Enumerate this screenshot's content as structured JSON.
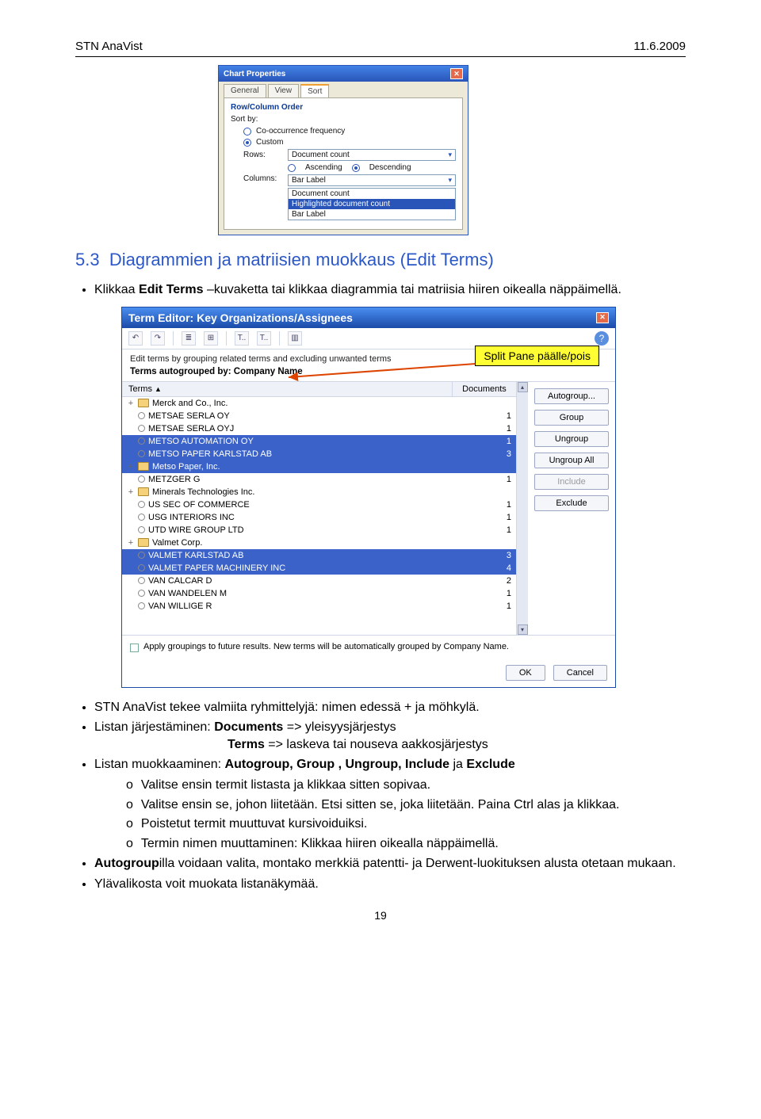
{
  "header": {
    "left": "STN AnaVist",
    "right": "11.6.2009"
  },
  "chartProps": {
    "title": "Chart Properties",
    "tabs": [
      "General",
      "View",
      "Sort"
    ],
    "rowColOrder": "Row/Column Order",
    "sortBy": "Sort by:",
    "opt1": "Co-occurrence frequency",
    "opt2": "Custom",
    "rows": "Rows:",
    "rowsVal": "Document count",
    "asc": "Ascending",
    "desc": "Descending",
    "cols": "Columns:",
    "colsVal": "Bar Label",
    "listItems": [
      "Document count",
      "Highlighted document count",
      "Bar Label"
    ]
  },
  "section": {
    "num": "5.3",
    "title": "Diagrammien ja matriisien muokkaus (Edit Terms)"
  },
  "bullet1a": "Klikkaa ",
  "bullet1b": "Edit Terms",
  "bullet1c": " –kuvaketta tai klikkaa diagrammia tai matriisia hiiren oikealla näppäimellä.",
  "termEditor": {
    "title": "Term Editor: Key Organizations/Assignees",
    "desc": "Edit terms by grouping related terms and excluding unwanted terms",
    "autogrouped": "Terms autogrouped by: Company Name",
    "col1": "Terms",
    "col2": "Documents",
    "rows": [
      {
        "exp": "+",
        "icon": "folder",
        "name": "Merck and Co., Inc.",
        "val": "",
        "sel": false
      },
      {
        "exp": "",
        "icon": "circ",
        "name": "METSAE SERLA OY",
        "val": "1",
        "sel": false
      },
      {
        "exp": "",
        "icon": "circ",
        "name": "METSAE SERLA OYJ",
        "val": "1",
        "sel": false
      },
      {
        "exp": "",
        "icon": "circ",
        "name": "METSO AUTOMATION OY",
        "val": "1",
        "sel": true
      },
      {
        "exp": "",
        "icon": "circ",
        "name": "METSO PAPER KARLSTAD AB",
        "val": "3",
        "sel": true
      },
      {
        "exp": "+",
        "icon": "folder",
        "name": "Metso Paper, Inc.",
        "val": "",
        "sel": true
      },
      {
        "exp": "",
        "icon": "circ",
        "name": "METZGER G",
        "val": "1",
        "sel": false
      },
      {
        "exp": "+",
        "icon": "folder",
        "name": "Minerals Technologies Inc.",
        "val": "",
        "sel": false
      },
      {
        "exp": "",
        "icon": "circ",
        "name": "US SEC OF COMMERCE",
        "val": "1",
        "sel": false
      },
      {
        "exp": "",
        "icon": "circ",
        "name": "USG INTERIORS INC",
        "val": "1",
        "sel": false
      },
      {
        "exp": "",
        "icon": "circ",
        "name": "UTD WIRE GROUP LTD",
        "val": "1",
        "sel": false
      },
      {
        "exp": "+",
        "icon": "folder",
        "name": "Valmet Corp.",
        "val": "",
        "sel": false
      },
      {
        "exp": "",
        "icon": "circ",
        "name": "VALMET KARLSTAD AB",
        "val": "3",
        "sel": true
      },
      {
        "exp": "",
        "icon": "circ",
        "name": "VALMET PAPER MACHINERY INC",
        "val": "4",
        "sel": true
      },
      {
        "exp": "",
        "icon": "circ",
        "name": "VAN CALCAR D",
        "val": "2",
        "sel": false
      },
      {
        "exp": "",
        "icon": "circ",
        "name": "VAN WANDELEN M",
        "val": "1",
        "sel": false
      },
      {
        "exp": "",
        "icon": "circ",
        "name": "VAN WILLIGE R",
        "val": "1",
        "sel": false
      }
    ],
    "sideButtons": [
      {
        "label": "Autogroup...",
        "dis": false
      },
      {
        "label": "Group",
        "dis": false
      },
      {
        "label": "Ungroup",
        "dis": false
      },
      {
        "label": "Ungroup All",
        "dis": false
      },
      {
        "label": "Include",
        "dis": true
      },
      {
        "label": "Exclude",
        "dis": false
      }
    ],
    "checkText": "Apply groupings to future results. New terms will be automatically grouped by Company Name.",
    "ok": "OK",
    "cancel": "Cancel"
  },
  "callout": "Split Pane päälle/pois",
  "after": {
    "b1": "STN AnaVist tekee valmiita ryhmittelyjä: nimen edessä + ja möhkylä.",
    "b2a": "Listan järjestäminen: ",
    "b2b": "Documents",
    "b2c": " => yleisyysjärjestys",
    "b2d": "Terms",
    "b2e": " => laskeva tai nouseva aakkosjärjestys",
    "b3a": "Listan muokkaaminen: ",
    "b3b": "Autogroup, Group , Ungroup, Include",
    "b3c": " ja ",
    "b3d": "Exclude",
    "s1": "Valitse ensin termit listasta ja klikkaa sitten sopivaa.",
    "s2": "Valitse ensin se, johon liitetään. Etsi sitten se, joka liitetään. Paina Ctrl alas ja klikkaa.",
    "s3": "Poistetut termit muuttuvat kursivoiduiksi.",
    "s4": "Termin nimen muuttaminen: Klikkaa hiiren oikealla näppäimellä.",
    "b4a": "Autogroup",
    "b4b": "illa voidaan valita, montako merkkiä patentti- ja Derwent-luokituksen alusta otetaan mukaan.",
    "b5": "Ylävalikosta voit muokata listanäkymää."
  },
  "pageNum": "19"
}
